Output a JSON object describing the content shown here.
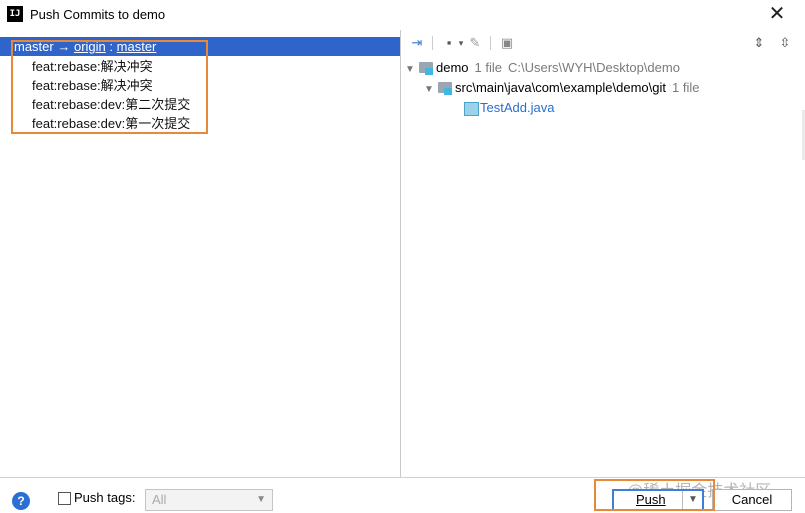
{
  "window": {
    "title": "Push Commits to demo",
    "app_icon_text": "IJ"
  },
  "left": {
    "branch": {
      "local": "master",
      "arrow": "→",
      "remote": "origin",
      "sep": ":",
      "target": "master"
    },
    "commits": [
      "feat:rebase:解决冲突",
      "feat:rebase:解决冲突",
      "feat:rebase:dev:第二次提交",
      "feat:rebase:dev:第一次提交"
    ]
  },
  "right": {
    "tree": {
      "root": {
        "name": "demo",
        "count": "1 file",
        "path": "C:\\Users\\WYH\\Desktop\\demo"
      },
      "dir": {
        "name": "src\\main\\java\\com\\example\\demo\\git",
        "count": "1 file"
      },
      "file": {
        "name": "TestAdd.java"
      }
    }
  },
  "bottom": {
    "help": "?",
    "push_tags_label": "Push tags:",
    "push_tags_value": "All",
    "push_label": "Push",
    "cancel_label": "Cancel",
    "watermark": "@稀土掘金技术社区"
  },
  "colors": {
    "selection": "#2f65ca",
    "highlight_box": "#e8893a",
    "accent": "#2c6fd2"
  }
}
